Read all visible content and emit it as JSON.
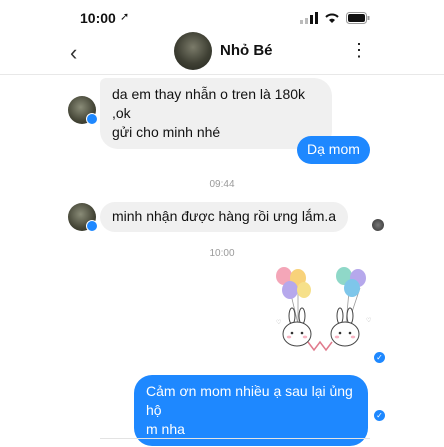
{
  "status": {
    "time": "10:00"
  },
  "header": {
    "contact_name": "Nhỏ Bé"
  },
  "messages": [
    {
      "line1": "da em thay nhẫn o tren là 180k  ,ok",
      "line2": "gửi cho minh nhé"
    },
    {
      "text": "Dạ mom"
    },
    {
      "text": "minh nhận được hàng rồi ưng lắm.a"
    },
    {
      "line1": "Cảm ơn mom nhiều ạ sau lại ủng hộ",
      "line2": "m nha"
    }
  ],
  "timestamps": [
    "09:44",
    "10:00"
  ],
  "colors": {
    "accent": "#1e88ff",
    "incoming_bubble": "#f0f0f0"
  },
  "icons": [
    "back-chevron-icon",
    "more-options-icon",
    "signal-icon",
    "wifi-icon",
    "battery-icon",
    "messenger-badge-icon",
    "seen-check-icon"
  ]
}
